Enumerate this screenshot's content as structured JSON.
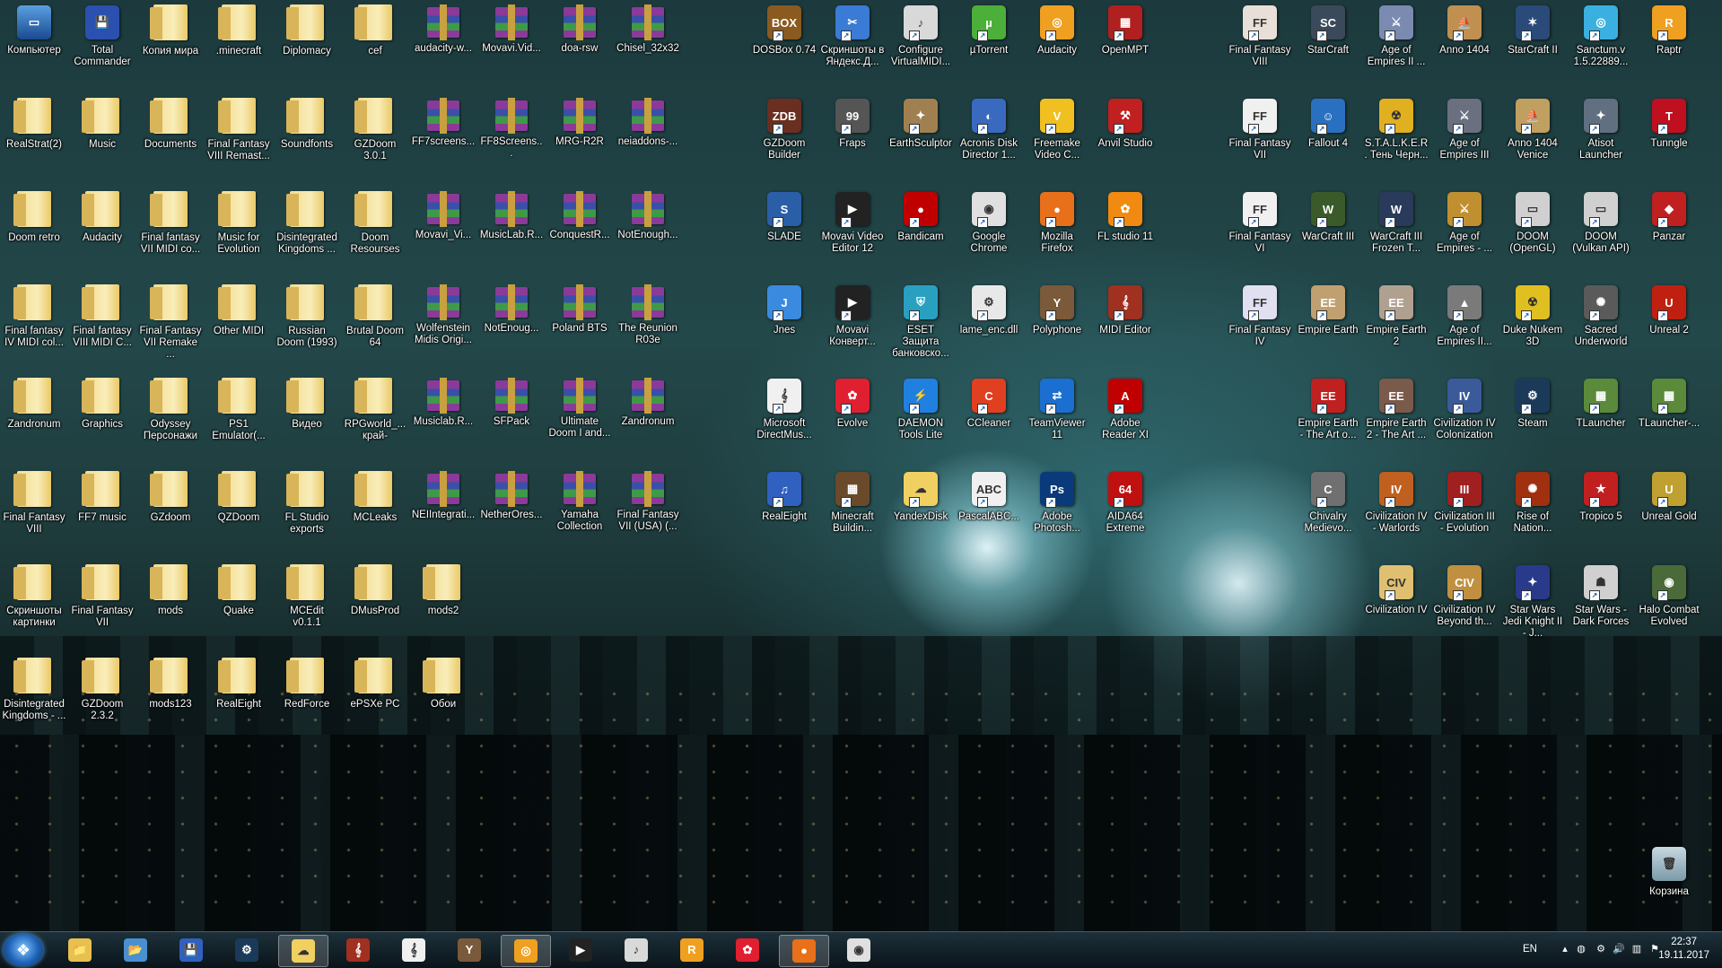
{
  "desktop_left": [
    [
      {
        "label": "Компьютер",
        "type": "computer"
      },
      {
        "label": "Total Commander",
        "type": "floppy"
      },
      {
        "label": "Копия мира",
        "type": "folder"
      },
      {
        "label": ".minecraft",
        "type": "folder"
      },
      {
        "label": "Diplomacy",
        "type": "folder"
      },
      {
        "label": "cef",
        "type": "folder"
      },
      {
        "label": "audacity-w...",
        "type": "rar"
      },
      {
        "label": "Movavi.Vid...",
        "type": "rar"
      },
      {
        "label": "doa-rsw",
        "type": "rar"
      },
      {
        "label": "Chisel_32x32",
        "type": "rar"
      }
    ],
    [
      {
        "label": "RealStrat(2)",
        "type": "folder"
      },
      {
        "label": "Music",
        "type": "folder"
      },
      {
        "label": "Documents",
        "type": "folder"
      },
      {
        "label": "Final Fantasy VIII Remast...",
        "type": "folder"
      },
      {
        "label": "Soundfonts",
        "type": "folder"
      },
      {
        "label": "GZDoom 3.0.1",
        "type": "folder"
      },
      {
        "label": "FF7screens...",
        "type": "rar"
      },
      {
        "label": "FF8Screens...",
        "type": "rar"
      },
      {
        "label": "MRG-R2R",
        "type": "rar"
      },
      {
        "label": "neiaddons-...",
        "type": "rar"
      }
    ],
    [
      {
        "label": "Doom retro",
        "type": "folder"
      },
      {
        "label": "Audacity",
        "type": "folder"
      },
      {
        "label": "Final fantasy VII MIDI co...",
        "type": "folder"
      },
      {
        "label": "Music for Evolution",
        "type": "folder"
      },
      {
        "label": "Disintegrated Kingdoms ...",
        "type": "folder"
      },
      {
        "label": "Doom Resourses",
        "type": "folder"
      },
      {
        "label": "Movavi_Vi...",
        "type": "rar"
      },
      {
        "label": "MusicLab.R...",
        "type": "rar"
      },
      {
        "label": "ConquestR...",
        "type": "rar"
      },
      {
        "label": "NotEnough...",
        "type": "rar"
      }
    ],
    [
      {
        "label": "Final fantasy IV MIDI col...",
        "type": "folder"
      },
      {
        "label": "Final fantasy VIII MIDI C...",
        "type": "folder"
      },
      {
        "label": "Final Fantasy VII Remake ...",
        "type": "folder"
      },
      {
        "label": "Other MIDI",
        "type": "folder"
      },
      {
        "label": "Russian Doom (1993)",
        "type": "folder"
      },
      {
        "label": "Brutal Doom 64",
        "type": "folder"
      },
      {
        "label": "Wolfenstein Midis Origi...",
        "type": "rar"
      },
      {
        "label": "NotEnoug...",
        "type": "rar"
      },
      {
        "label": "Poland BTS",
        "type": "rar"
      },
      {
        "label": "The Reunion R03e",
        "type": "rar"
      }
    ],
    [
      {
        "label": "Zandronum",
        "type": "folder"
      },
      {
        "label": "Graphics",
        "type": "folder"
      },
      {
        "label": "Odyssey Персонажи",
        "type": "folder"
      },
      {
        "label": "PS1 Emulator(...",
        "type": "folder"
      },
      {
        "label": "Видео",
        "type": "folder"
      },
      {
        "label": "RPGworld_... край-",
        "type": "folder"
      },
      {
        "label": "Musiclab.R...",
        "type": "rar"
      },
      {
        "label": "SFPack",
        "type": "rar"
      },
      {
        "label": "Ultimate Doom I and...",
        "type": "rar"
      },
      {
        "label": "Zandronum",
        "type": "rar"
      }
    ],
    [
      {
        "label": "Final Fantasy VIII",
        "type": "folder"
      },
      {
        "label": "FF7 music",
        "type": "folder"
      },
      {
        "label": "GZdoom",
        "type": "folder"
      },
      {
        "label": "QZDoom",
        "type": "folder"
      },
      {
        "label": "FL Studio exports",
        "type": "folder"
      },
      {
        "label": "MCLeaks",
        "type": "folder"
      },
      {
        "label": "NEIIntegrati...",
        "type": "rar"
      },
      {
        "label": "NetherOres...",
        "type": "rar"
      },
      {
        "label": "Yamaha Collection",
        "type": "rar"
      },
      {
        "label": "Final Fantasy VII (USA) (...",
        "type": "rar"
      }
    ],
    [
      {
        "label": "Скриншоты картинки",
        "type": "folder"
      },
      {
        "label": "Final Fantasy VII",
        "type": "folder"
      },
      {
        "label": "mods",
        "type": "folder"
      },
      {
        "label": "Quake",
        "type": "folder"
      },
      {
        "label": "MCEdit v0.1.1",
        "type": "folder"
      },
      {
        "label": "DMusProd",
        "type": "folder"
      },
      {
        "label": "mods2",
        "type": "folder"
      }
    ],
    [
      {
        "label": "Disintegrated Kingdoms - ...",
        "type": "folder"
      },
      {
        "label": "GZDoom 2.3.2",
        "type": "folder"
      },
      {
        "label": "mods123",
        "type": "folder"
      },
      {
        "label": "RealEight",
        "type": "folder"
      },
      {
        "label": "RedForce",
        "type": "folder"
      },
      {
        "label": "ePSXe PC",
        "type": "folder"
      },
      {
        "label": "Обои",
        "type": "folder"
      }
    ]
  ],
  "desktop_mid": [
    [
      {
        "label": "DOSBox 0.74",
        "color": "#8a5a20",
        "glyph": "BOX"
      },
      {
        "label": "Скриншоты в Яндекс.Д...",
        "color": "#3a7bd5",
        "glyph": "✂"
      },
      {
        "label": "Configure VirtualMIDI...",
        "color": "#d9d9d9",
        "glyph": "♪"
      },
      {
        "label": "µTorrent",
        "color": "#4caf3a",
        "glyph": "µ"
      },
      {
        "label": "Audacity",
        "color": "#f0a020",
        "glyph": "◎"
      },
      {
        "label": "OpenMPT",
        "color": "#b02020",
        "glyph": "▦"
      }
    ],
    [
      {
        "label": "GZDoom Builder",
        "color": "#6a2f20",
        "glyph": "ZDB"
      },
      {
        "label": "Fraps",
        "color": "#555",
        "glyph": "99"
      },
      {
        "label": "EarthSculptor",
        "color": "#a08050",
        "glyph": "✦"
      },
      {
        "label": "Acronis Disk Director 1...",
        "color": "#3a6ac0",
        "glyph": "◐"
      },
      {
        "label": "Freemake Video C...",
        "color": "#f0c020",
        "glyph": "V"
      },
      {
        "label": "Anvil Studio",
        "color": "#c02020",
        "glyph": "⚒"
      }
    ],
    [
      {
        "label": "SLADE",
        "color": "#2a5fa8",
        "glyph": "S"
      },
      {
        "label": "Movavi Video Editor 12",
        "color": "#222",
        "glyph": "▶"
      },
      {
        "label": "Bandicam",
        "color": "#c00000",
        "glyph": "●"
      },
      {
        "label": "Google Chrome",
        "color": "#e0e0e0",
        "glyph": "◉"
      },
      {
        "label": "Mozilla Firefox",
        "color": "#e8701a",
        "glyph": "●"
      },
      {
        "label": "FL studio 11",
        "color": "#f08a10",
        "glyph": "✿"
      }
    ],
    [
      {
        "label": "Jnes",
        "color": "#3a8ae0",
        "glyph": "J"
      },
      {
        "label": "Movavi Конверт...",
        "color": "#222",
        "glyph": "▶"
      },
      {
        "label": "ESET Защита банковско...",
        "color": "#2aa0c0",
        "glyph": "⛨"
      },
      {
        "label": "lame_enc.dll",
        "color": "#e8e8e8",
        "glyph": "⚙"
      },
      {
        "label": "Polyphone",
        "color": "#7a5a3a",
        "glyph": "Y"
      },
      {
        "label": "MIDI Editor",
        "color": "#a03020",
        "glyph": "𝄞"
      }
    ],
    [
      {
        "label": "Microsoft DirectMus...",
        "color": "#f0f0f0",
        "glyph": "𝄞"
      },
      {
        "label": "Evolve",
        "color": "#e02030",
        "glyph": "✿"
      },
      {
        "label": "DAEMON Tools Lite",
        "color": "#2080e0",
        "glyph": "⚡"
      },
      {
        "label": "CCleaner",
        "color": "#e04020",
        "glyph": "C"
      },
      {
        "label": "TeamViewer 11",
        "color": "#1a6fd0",
        "glyph": "⇄"
      },
      {
        "label": "Adobe Reader XI",
        "color": "#c00000",
        "glyph": "A"
      }
    ],
    [
      {
        "label": "RealEight",
        "color": "#3060c0",
        "glyph": "♫"
      },
      {
        "label": "Minecraft Buildin...",
        "color": "#6a4a2a",
        "glyph": "▦"
      },
      {
        "label": "YandexDisk",
        "color": "#f0d060",
        "glyph": "☁"
      },
      {
        "label": "PascalABC...",
        "color": "#f0f0f0",
        "glyph": "ABC"
      },
      {
        "label": "Adobe Photosh...",
        "color": "#0a3a7a",
        "glyph": "Ps"
      },
      {
        "label": "AIDA64 Extreme",
        "color": "#c01010",
        "glyph": "64"
      }
    ]
  ],
  "desktop_right": [
    [
      {
        "label": "Final Fantasy VIII",
        "color": "#e8e0d8",
        "glyph": "FF"
      },
      {
        "label": "StarCraft",
        "color": "#3a4a5a",
        "glyph": "SC"
      },
      {
        "label": "Age of Empires II ...",
        "color": "#7a8ab0",
        "glyph": "⚔"
      },
      {
        "label": "Anno 1404",
        "color": "#c09050",
        "glyph": "⛵"
      },
      {
        "label": "StarCraft II",
        "color": "#2a4a7a",
        "glyph": "✶"
      },
      {
        "label": "Sanctum.v 1.5.22889...",
        "color": "#3ab0e0",
        "glyph": "◎"
      },
      {
        "label": "Raptr",
        "color": "#f0a020",
        "glyph": "R"
      }
    ],
    [
      {
        "label": "Final Fantasy VII",
        "color": "#f0f0f0",
        "glyph": "FF"
      },
      {
        "label": "Fallout 4",
        "color": "#2a70c0",
        "glyph": "☺"
      },
      {
        "label": "S.T.A.L.K.E.R. Тень Черн...",
        "color": "#e0b020",
        "glyph": "☢"
      },
      {
        "label": "Age of Empires III",
        "color": "#6a7080",
        "glyph": "⚔"
      },
      {
        "label": "Anno 1404 Venice",
        "color": "#c0a060",
        "glyph": "⛵"
      },
      {
        "label": "Atisot Launcher",
        "color": "#607080",
        "glyph": "✦"
      },
      {
        "label": "Tunngle",
        "color": "#c01020",
        "glyph": "T"
      }
    ],
    [
      {
        "label": "Final Fantasy VI",
        "color": "#f0f0f0",
        "glyph": "FF"
      },
      {
        "label": "WarCraft III",
        "color": "#3a5a2a",
        "glyph": "W"
      },
      {
        "label": "WarCraft III Frozen T...",
        "color": "#2a3a5a",
        "glyph": "W"
      },
      {
        "label": "Age of Empires - ...",
        "color": "#c09030",
        "glyph": "⚔"
      },
      {
        "label": "DOOM (OpenGL)",
        "color": "#d0d0d0",
        "glyph": "▭"
      },
      {
        "label": "DOOM (Vulkan API)",
        "color": "#d0d0d0",
        "glyph": "▭"
      },
      {
        "label": "Panzar",
        "color": "#c02020",
        "glyph": "◆"
      }
    ],
    [
      {
        "label": "Final Fantasy IV",
        "color": "#e0e0f0",
        "glyph": "FF"
      },
      {
        "label": "Empire Earth",
        "color": "#c0a070",
        "glyph": "EE"
      },
      {
        "label": "Empire Earth 2",
        "color": "#b0a090",
        "glyph": "EE"
      },
      {
        "label": "Age of Empires II...",
        "color": "#7a7a7a",
        "glyph": "▲"
      },
      {
        "label": "Duke Nukem 3D",
        "color": "#e0c020",
        "glyph": "☢"
      },
      {
        "label": "Sacred Underworld",
        "color": "#5a5a5a",
        "glyph": "✺"
      },
      {
        "label": "Unreal 2",
        "color": "#c02010",
        "glyph": "U"
      }
    ],
    [
      {
        "label": "Empire Earth - The Art o...",
        "color": "#c02020",
        "glyph": "EE"
      },
      {
        "label": "Empire Earth 2 - The Art ...",
        "color": "#7a5a4a",
        "glyph": "EE"
      },
      {
        "label": "Civilization IV Colonization",
        "color": "#3a5a9a",
        "glyph": "IV"
      },
      {
        "label": "Steam",
        "color": "#1b3a5a",
        "glyph": "⚙"
      },
      {
        "label": "TLauncher",
        "color": "#5a8a3a",
        "glyph": "▦"
      },
      {
        "label": "TLauncher-...",
        "color": "#5a8a3a",
        "glyph": "▦"
      }
    ],
    [
      {
        "label": "Chivalry Medievo...",
        "color": "#707070",
        "glyph": "C"
      },
      {
        "label": "Civilization IV - Warlords",
        "color": "#c06020",
        "glyph": "IV"
      },
      {
        "label": "Civilization III - Evolution",
        "color": "#a02020",
        "glyph": "III"
      },
      {
        "label": "Rise of Nation...",
        "color": "#a03010",
        "glyph": "✺"
      },
      {
        "label": "Tropico 5",
        "color": "#c02020",
        "glyph": "★"
      },
      {
        "label": "Unreal Gold",
        "color": "#c0a030",
        "glyph": "U"
      }
    ],
    [
      {
        "label": "Civilization IV",
        "color": "#e0c070",
        "glyph": "CIV"
      },
      {
        "label": "Civilization IV Beyond th...",
        "color": "#c09040",
        "glyph": "CIV"
      },
      {
        "label": "Star Wars Jedi Knight II - J...",
        "color": "#2a3a8a",
        "glyph": "✦"
      },
      {
        "label": "Star Wars - Dark Forces",
        "color": "#d0d0d0",
        "glyph": "☗"
      },
      {
        "label": "Halo Combat Evolved",
        "color": "#4a6a3a",
        "glyph": "◉"
      }
    ]
  ],
  "recycle_bin": {
    "label": "Корзина"
  },
  "taskbar": {
    "items": [
      {
        "name": "explorer-taskbar",
        "glyph": "📁",
        "color": "#e8c050"
      },
      {
        "name": "libraries-taskbar",
        "glyph": "📂",
        "color": "#4a90d0"
      },
      {
        "name": "totalcmd-taskbar",
        "glyph": "💾",
        "color": "#3060c0"
      },
      {
        "name": "steam-taskbar",
        "glyph": "⚙",
        "color": "#1b3a5a"
      },
      {
        "name": "yandexdisk-taskbar",
        "glyph": "☁",
        "color": "#f0d060"
      },
      {
        "name": "midi-editor-taskbar",
        "glyph": "𝄞",
        "color": "#a03020"
      },
      {
        "name": "directmusic-taskbar",
        "glyph": "𝄞",
        "color": "#f0f0f0"
      },
      {
        "name": "polyphone-taskbar",
        "glyph": "Y",
        "color": "#7a5a3a"
      },
      {
        "name": "audacity-taskbar",
        "glyph": "◎",
        "color": "#f0a020"
      },
      {
        "name": "movavi-taskbar",
        "glyph": "▶",
        "color": "#222"
      },
      {
        "name": "virtualmidi-taskbar",
        "glyph": "♪",
        "color": "#d9d9d9"
      },
      {
        "name": "raptr-taskbar",
        "glyph": "R",
        "color": "#f0a020"
      },
      {
        "name": "evolve-taskbar",
        "glyph": "✿",
        "color": "#e02030"
      },
      {
        "name": "firefox-taskbar",
        "glyph": "●",
        "color": "#e8701a"
      },
      {
        "name": "chrome-taskbar",
        "glyph": "◉",
        "color": "#e0e0e0"
      }
    ],
    "active_index": [
      4,
      8,
      13
    ],
    "lang": "EN",
    "time": "22:37",
    "date": "19.11.2017"
  }
}
